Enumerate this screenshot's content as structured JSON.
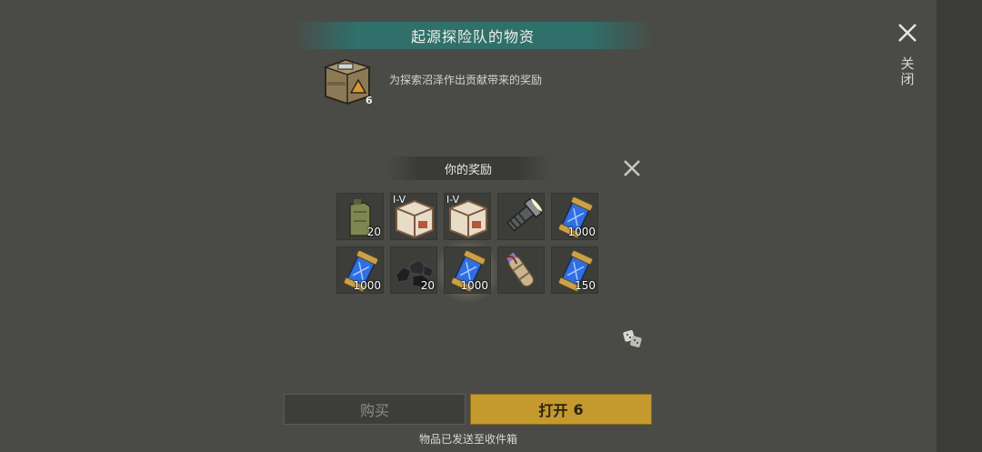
{
  "header": {
    "title": "起源探险队的物资"
  },
  "crate": {
    "count": "6",
    "description": "为探索沼泽作出贡献带来的奖励"
  },
  "close_main": {
    "label": "关闭"
  },
  "rewards": {
    "title": "你的奖励",
    "items": [
      {
        "name": "jerrycan",
        "qty": "20",
        "tier": ""
      },
      {
        "name": "white-crate",
        "qty": "",
        "tier": "I-V"
      },
      {
        "name": "white-crate",
        "qty": "",
        "tier": "I-V"
      },
      {
        "name": "flashlight",
        "qty": "",
        "tier": ""
      },
      {
        "name": "blue-capsule",
        "qty": "1000",
        "tier": ""
      },
      {
        "name": "blue-capsule",
        "qty": "1000",
        "tier": ""
      },
      {
        "name": "coal",
        "qty": "20",
        "tier": ""
      },
      {
        "name": "blue-capsule",
        "qty": "1000",
        "tier": ""
      },
      {
        "name": "scroll-pouch",
        "qty": "",
        "tier": ""
      },
      {
        "name": "blue-capsule",
        "qty": "150",
        "tier": ""
      }
    ]
  },
  "buttons": {
    "buy": "购买",
    "open": "打开",
    "open_count": "6"
  },
  "footer": {
    "note": "物品已发送至收件箱"
  },
  "colors": {
    "background": "#4a4b47",
    "accent_gold": "#c49a2e",
    "banner_teal": "#2f706b"
  }
}
